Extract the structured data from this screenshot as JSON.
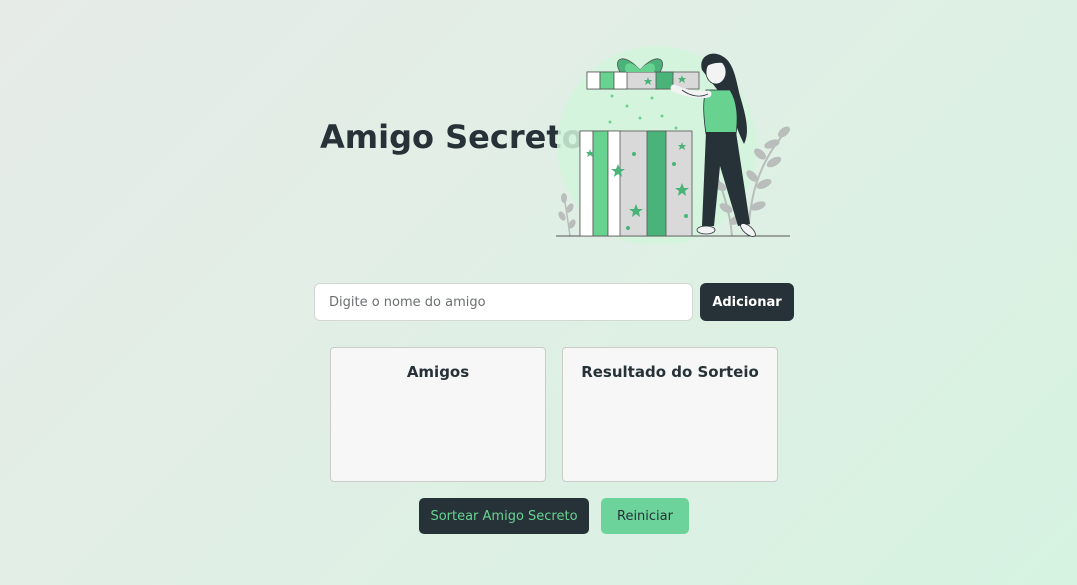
{
  "header": {
    "title": "Amigo Secreto",
    "illustration_icon": "woman-with-gift-illustration"
  },
  "form": {
    "input_placeholder": "Digite o nome do amigo",
    "input_value": "",
    "add_button_label": "Adicionar"
  },
  "panels": {
    "friends_title": "Amigos",
    "friends_items": [],
    "result_title": "Resultado do Sorteio",
    "result_items": []
  },
  "actions": {
    "draw_label": "Sortear Amigo Secreto",
    "reset_label": "Reiniciar"
  },
  "colors": {
    "dark": "#263238",
    "accent_green": "#68d391",
    "panel_bg": "#f7f7f7"
  }
}
